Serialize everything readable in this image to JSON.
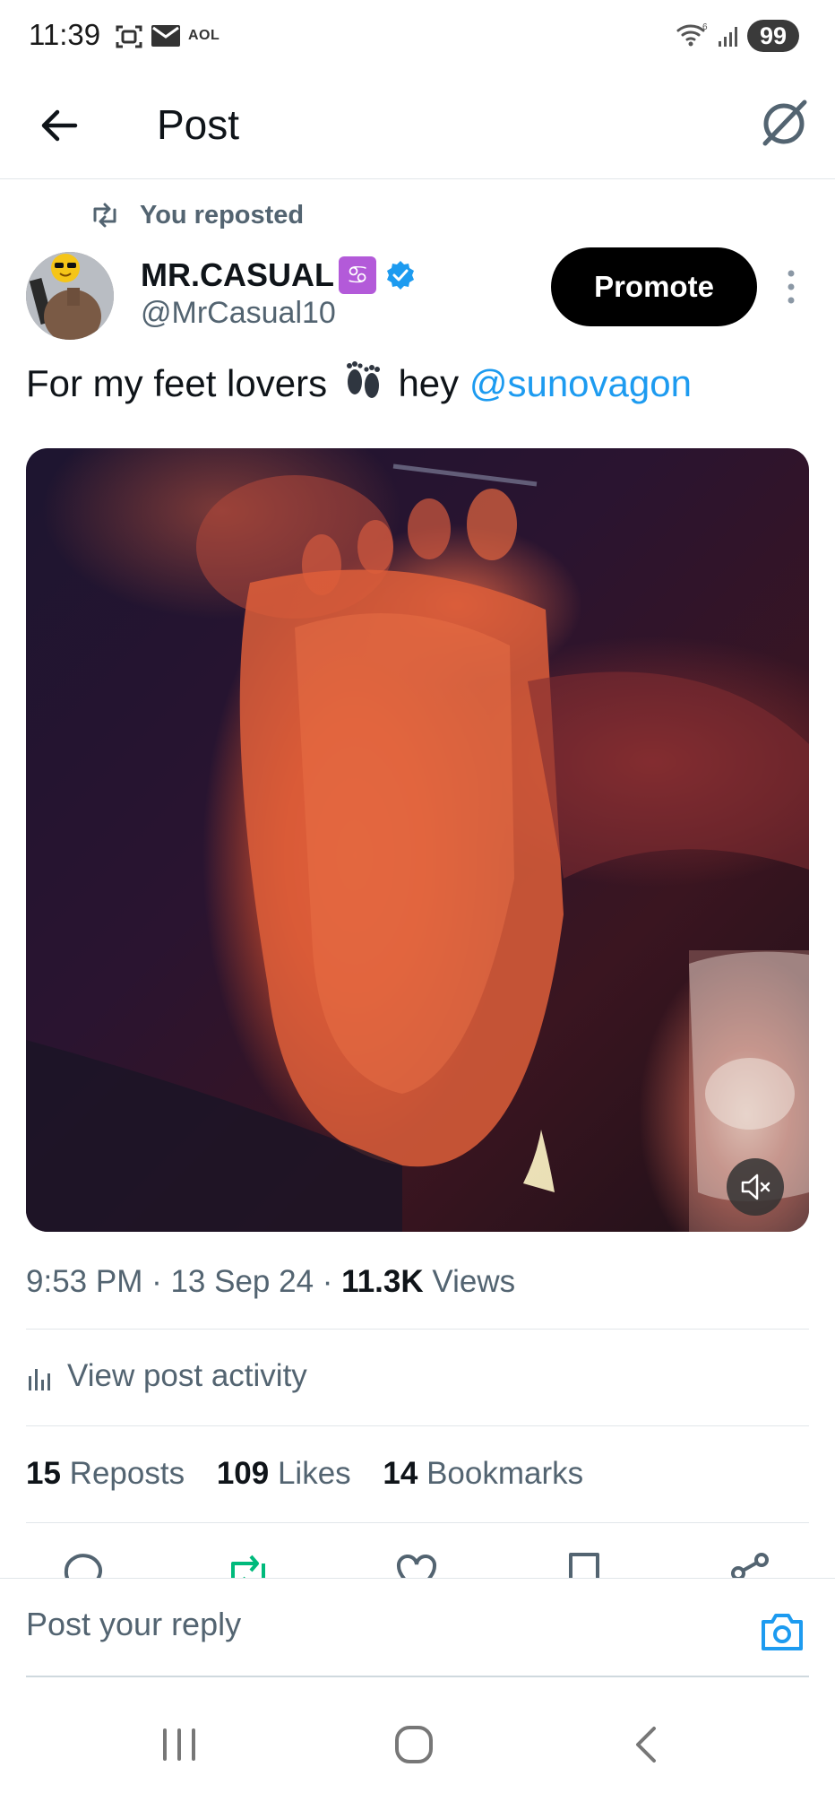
{
  "status_bar": {
    "time": "11:39",
    "carrier_label": "AOL",
    "battery": "99",
    "icons": [
      "screenshot-icon",
      "mail-icon",
      "wifi-icon",
      "signal-icon"
    ]
  },
  "header": {
    "title": "Post",
    "back_icon": "arrow-left-icon",
    "grok_icon": "grok-icon"
  },
  "repost_banner": {
    "text": "You reposted"
  },
  "author": {
    "name": "MR.CASUAL",
    "zodiac_badge": "♋",
    "handle": "@MrCasual10",
    "verified": true
  },
  "promote_label": "Promote",
  "post": {
    "text_before": "For my feet lovers",
    "text_middle": "hey",
    "mention": "@sunovagon"
  },
  "media": {
    "type": "video",
    "muted": true
  },
  "meta": {
    "time": "9:53 PM",
    "date": "13 Sep 24",
    "views_count": "11.3K",
    "views_label": "Views"
  },
  "activity_label": "View post activity",
  "stats": {
    "reposts_count": "15",
    "reposts_label": "Reposts",
    "likes_count": "109",
    "likes_label": "Likes",
    "bookmarks_count": "14",
    "bookmarks_label": "Bookmarks"
  },
  "reply": {
    "placeholder": "Post your reply"
  },
  "colors": {
    "accent": "#1d9bf0",
    "repost_green": "#00ba7c",
    "text_primary": "#0f1419",
    "text_secondary": "#536471"
  }
}
